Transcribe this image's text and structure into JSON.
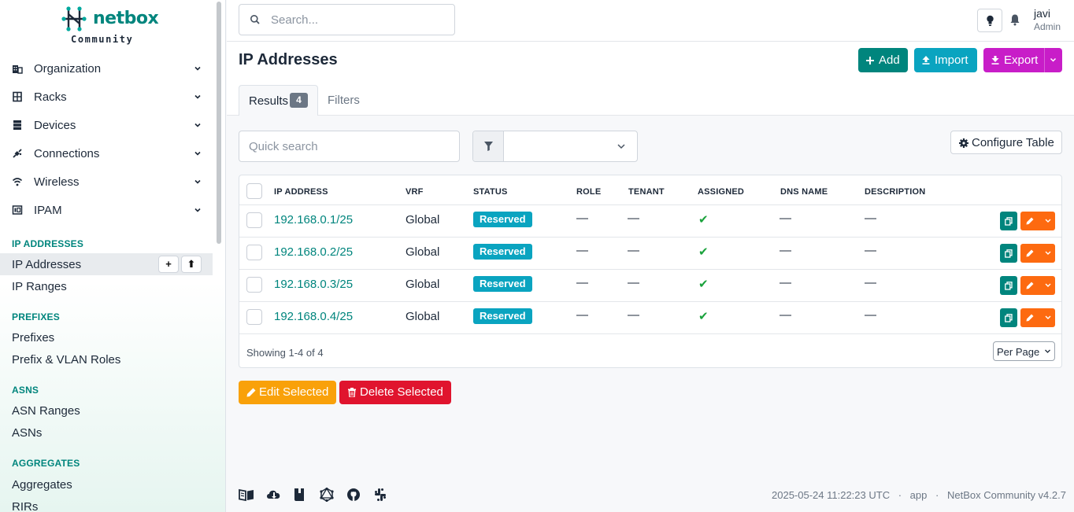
{
  "brand": {
    "name": "netbox",
    "edition": "Community"
  },
  "sidebar": {
    "menu": [
      {
        "label": "Organization",
        "icon": "domain-icon"
      },
      {
        "label": "Racks",
        "icon": "rack-icon"
      },
      {
        "label": "Devices",
        "icon": "server-icon"
      },
      {
        "label": "Connections",
        "icon": "plug-icon"
      },
      {
        "label": "Wireless",
        "icon": "wifi-icon"
      },
      {
        "label": "IPAM",
        "icon": "ip-icon"
      }
    ],
    "sections": [
      {
        "title": "IP ADDRESSES",
        "items": [
          "IP Addresses",
          "IP Ranges"
        ]
      },
      {
        "title": "PREFIXES",
        "items": [
          "Prefixes",
          "Prefix & VLAN Roles"
        ]
      },
      {
        "title": "ASNS",
        "items": [
          "ASN Ranges",
          "ASNs"
        ]
      },
      {
        "title": "AGGREGATES",
        "items": [
          "Aggregates",
          "RIRs"
        ]
      }
    ],
    "active_item": "IP Addresses",
    "add_label": "+",
    "import_label": "⬆"
  },
  "header": {
    "search_placeholder": "Search...",
    "user": {
      "name": "javi",
      "role": "Admin"
    }
  },
  "page": {
    "title": "IP Addresses",
    "actions": {
      "add": "Add",
      "import": "Import",
      "export": "Export"
    },
    "tabs": {
      "results": "Results",
      "results_count": "4",
      "filters": "Filters"
    }
  },
  "toolbar": {
    "quick_search_placeholder": "Quick search",
    "configure_table": "Configure Table"
  },
  "table": {
    "headers": [
      "IP ADDRESS",
      "VRF",
      "STATUS",
      "ROLE",
      "TENANT",
      "ASSIGNED",
      "DNS NAME",
      "DESCRIPTION"
    ],
    "rows": [
      {
        "ip": "192.168.0.1/25",
        "vrf": "Global",
        "status": "Reserved",
        "role": "—",
        "tenant": "—",
        "assigned": "✔",
        "dns": "—",
        "description": "—"
      },
      {
        "ip": "192.168.0.2/25",
        "vrf": "Global",
        "status": "Reserved",
        "role": "—",
        "tenant": "—",
        "assigned": "✔",
        "dns": "—",
        "description": "—"
      },
      {
        "ip": "192.168.0.3/25",
        "vrf": "Global",
        "status": "Reserved",
        "role": "—",
        "tenant": "—",
        "assigned": "✔",
        "dns": "—",
        "description": "—"
      },
      {
        "ip": "192.168.0.4/25",
        "vrf": "Global",
        "status": "Reserved",
        "role": "—",
        "tenant": "—",
        "assigned": "✔",
        "dns": "—",
        "description": "—"
      }
    ],
    "showing": "Showing 1-4 of 4",
    "per_page": "Per Page"
  },
  "bulk": {
    "edit": "Edit Selected",
    "delete": "Delete Selected"
  },
  "footer": {
    "icons": [
      "book-icon",
      "cloud-download-icon",
      "docs-icon",
      "graphql-icon",
      "github-icon",
      "slack-icon"
    ],
    "timestamp": "2025-05-24 11:22:23 UTC",
    "host": "app",
    "version": "NetBox Community v4.2.7"
  },
  "colors": {
    "brand": "#00857d",
    "import": "#0aa4c0",
    "export": "#c81dc8",
    "edit": "#f9a10a",
    "delete": "#e0142e",
    "row_edit": "#fd6a10"
  }
}
